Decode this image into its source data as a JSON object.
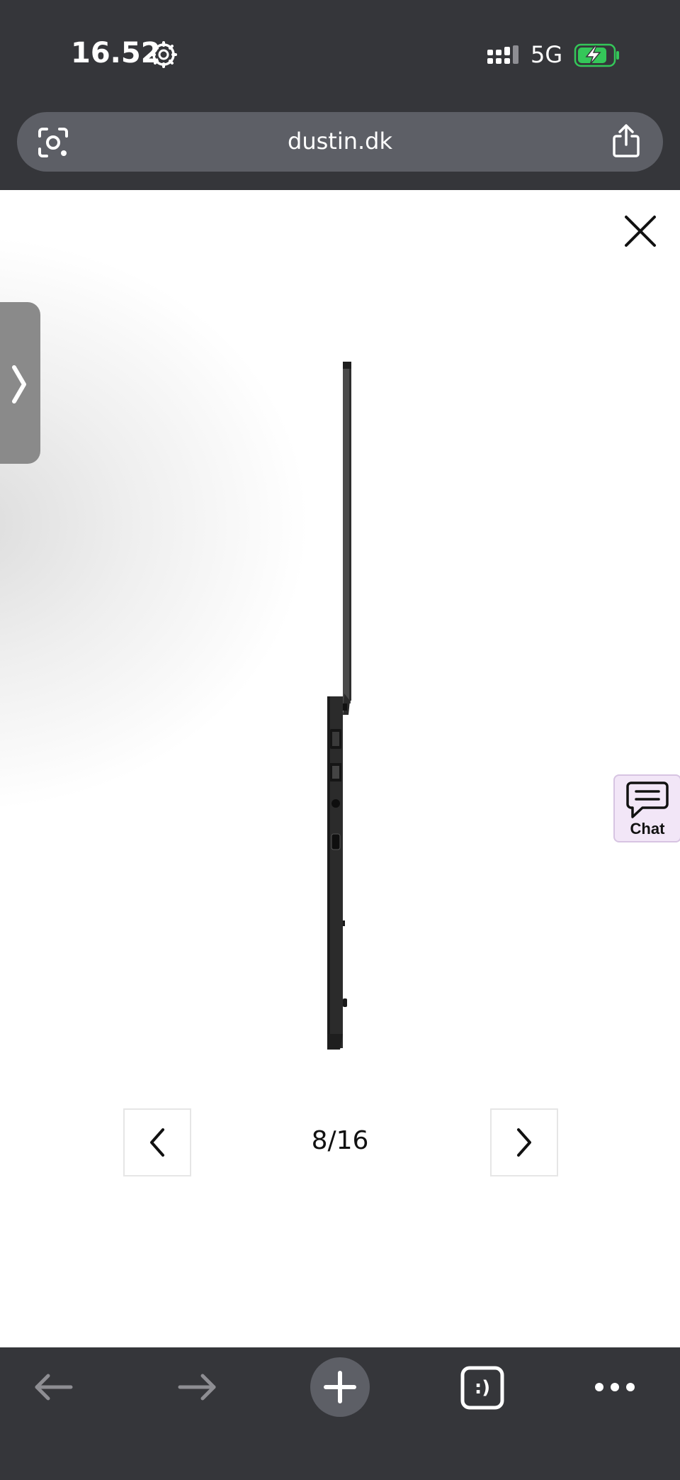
{
  "status_bar": {
    "time": "16.52",
    "network": "5G",
    "icons": [
      "gear-icon",
      "signal-icon",
      "battery-charging-icon"
    ]
  },
  "address_bar": {
    "url": "dustin.dk",
    "icons": [
      "lens-icon",
      "share-icon"
    ]
  },
  "gallery": {
    "page_counter": "8/16",
    "icons": [
      "close-icon",
      "chevron-left-icon",
      "chevron-right-icon"
    ]
  },
  "chat": {
    "label": "Chat"
  },
  "toolbar": {
    "items": [
      "back-icon",
      "forward-icon",
      "new-tab-icon",
      "tabs-icon",
      "more-icon"
    ],
    "tabs_glyph": ":)"
  },
  "colors": {
    "browser_chrome": "#35363a",
    "url_pill": "#5d5f66",
    "battery_fill": "#34c759",
    "chat_bg": "#f2e6f7"
  }
}
